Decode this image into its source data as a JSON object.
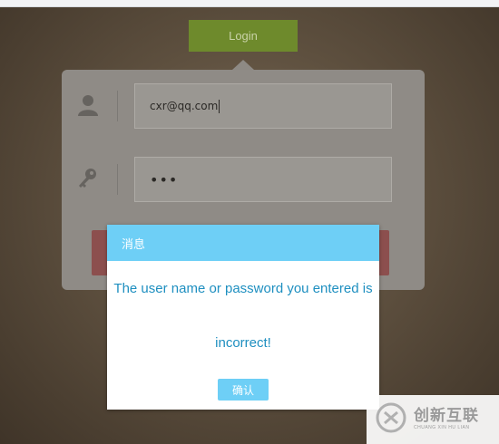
{
  "login": {
    "tab_label": "Login",
    "username_value": "cxr@qq.com",
    "password_mask": "•••"
  },
  "icons": {
    "user": "user-icon",
    "key": "key-icon"
  },
  "dialog": {
    "title": "消息",
    "message_line1": "The user name or password you entered is",
    "message_line2": "incorrect!",
    "confirm_label": "确认"
  },
  "watermark": {
    "cn": "创新互联",
    "en": "CHUANG XIN HU LIAN"
  },
  "colors": {
    "dialog_accent": "#6ecff6",
    "message_text": "#1e8fc0",
    "login_tab": "#6e8a2c"
  }
}
